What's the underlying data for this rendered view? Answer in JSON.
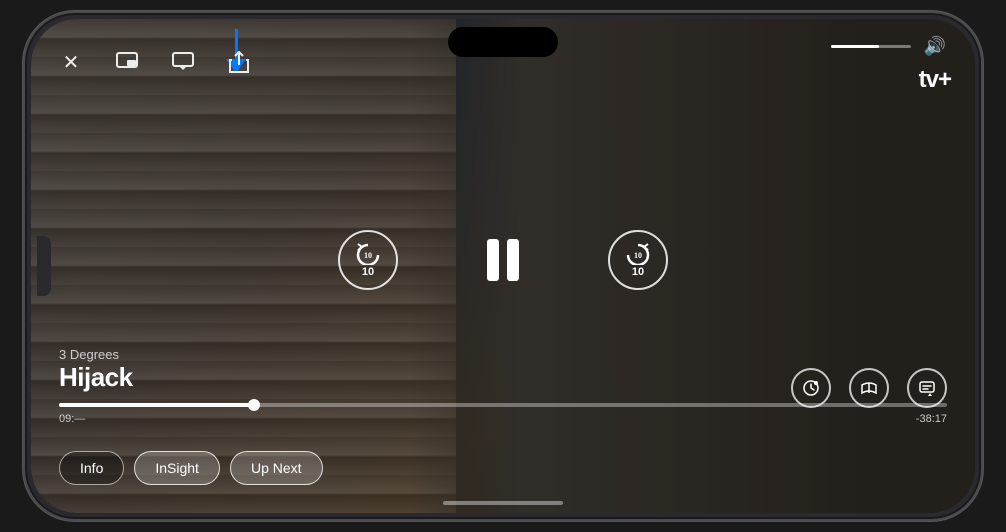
{
  "phone": {
    "dynamic_island": true
  },
  "video": {
    "show_subtitle": "3 Degrees",
    "show_title": "Hijack",
    "time_elapsed": "09:—",
    "time_remaining": "-38:17",
    "progress_percent": 22,
    "volume_percent": 60
  },
  "top_controls": {
    "close_icon": "✕",
    "pip_icon": "⊡",
    "airplay_icon": "▱",
    "share_icon": "↑",
    "volume_icon": "🔊"
  },
  "apple_tv": {
    "logo": "tv+",
    "apple_symbol": ""
  },
  "playback": {
    "rewind_seconds": "10",
    "forward_seconds": "10",
    "pause_label": "Pause"
  },
  "right_controls": {
    "speed_icon": "⏱",
    "audio_icon": "🎵",
    "subtitles_icon": "💬"
  },
  "bottom_tabs": [
    {
      "id": "info",
      "label": "Info",
      "active": false
    },
    {
      "id": "insight",
      "label": "InSight",
      "active": false
    },
    {
      "id": "up-next",
      "label": "Up Next",
      "active": true
    }
  ],
  "blue_arrow": {
    "label": "AirPlay indicator arrow"
  }
}
